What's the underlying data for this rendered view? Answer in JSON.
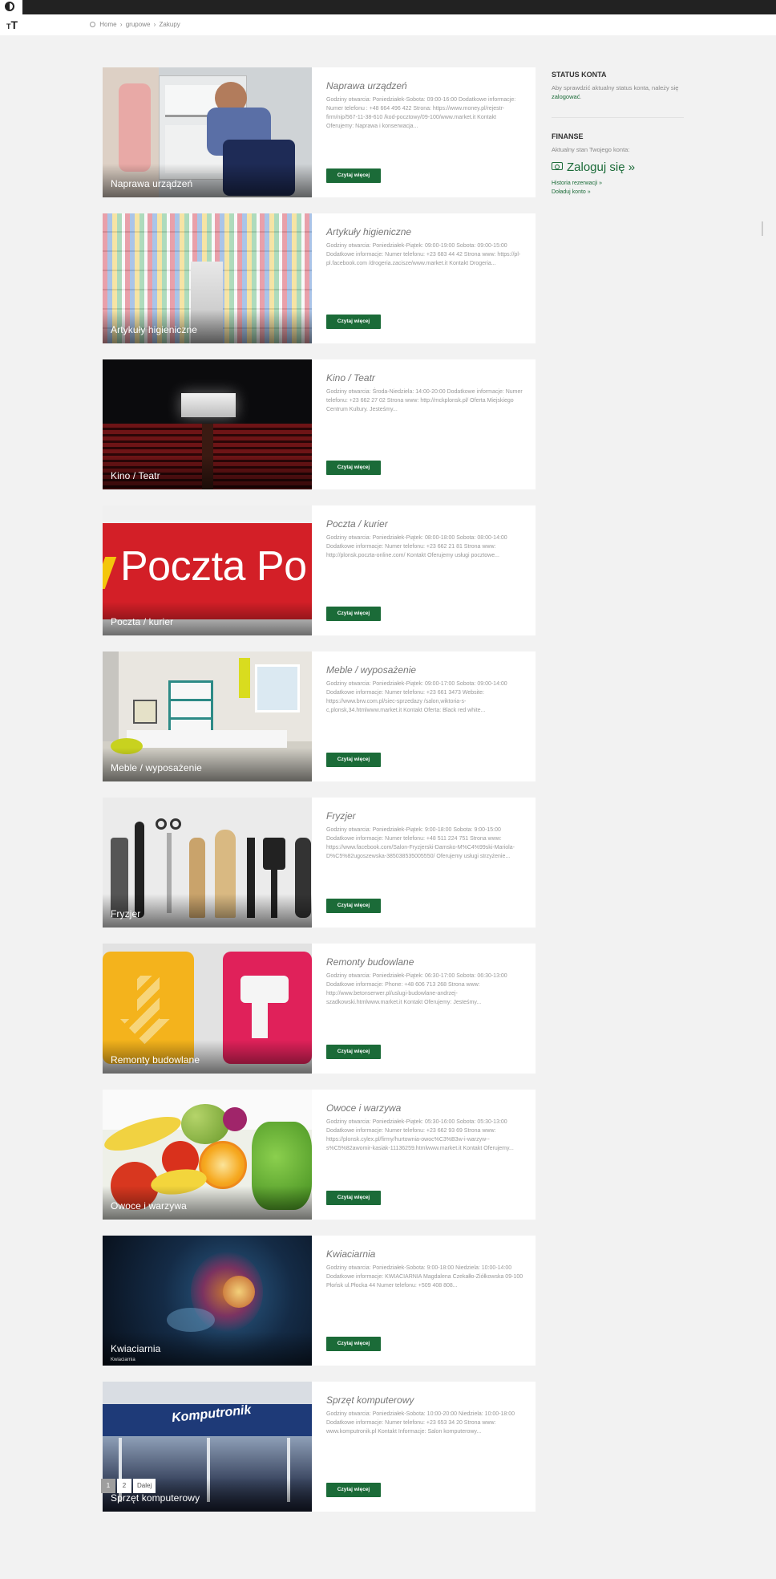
{
  "accessibility": {
    "contrast_icon": "contrast-icon",
    "text_size_label": "T"
  },
  "breadcrumb": {
    "items": [
      "Home",
      "grupowe",
      "Zakupy"
    ],
    "separator": "›"
  },
  "cards": [
    {
      "caption": "Naprawa urządzeń",
      "title": "Naprawa urządzeń",
      "desc": "Godziny otwarcia: Poniedziałek-Sobota: 09:00-16:00 Dodatkowe informacje: Numer telefonu : +48 664 496 422 Strona: https://www.money.pl/rejestr-firm/nip/567-11-38-610 /kod-pocztowy/09-100/www.market.it Kontakt Oferujemy: Naprawa i konserwacja...",
      "button": "Czytaj więcej"
    },
    {
      "caption": "Artykuły higieniczne",
      "title": "Artykuły higieniczne",
      "desc": "Godziny otwarcia: Poniedziałek-Piątek: 09:00-19:00 Sobota: 09:00-15:00 Dodatkowe informacje: Numer telefonu: +23 683 44 42 Strona www: https://pl-pl.facebook.com /drogeria.zacisze/www.market.it Kontakt Drogeria...",
      "button": "Czytaj więcej"
    },
    {
      "caption": "Kino / Teatr",
      "title": "Kino / Teatr",
      "desc": "Godziny otwarcia: Środa-Niedziela: 14:00-20:00 Dodatkowe informacje: Numer telefonu: +23 662 27 02 Strona www: http://mckplonsk.pl/ Oferta Miejskiego Centrum Kultury. Jesteśmy...",
      "button": "Czytaj więcej"
    },
    {
      "caption": "Poczta / kurier",
      "title": "Poczta / kurier",
      "desc": "Godziny otwarcia: Poniedziałek-Piątek: 08:00-18:00 Sobota: 08:00-14:00 Dodatkowe informacje: Numer telefonu: +23 662 21 81 Strona www: http://plonsk.poczta-online.com/ Kontakt Oferujemy usługi pocztowe...",
      "button": "Czytaj więcej"
    },
    {
      "caption": "Meble / wyposażenie",
      "title": "Meble / wyposażenie",
      "desc": "Godziny otwarcia: Poniedziałek-Piątek: 09:00-17:00 Sobota: 09:00-14:00 Dodatkowe informacje: Numer telefonu: +23 661 3473 Website: https://www.brw.com.pl/siec-sprzedazy /salon,wiktoria-s-c,plonsk,34.htmlwww.market.it Kontakt Oferta: Black red white...",
      "button": "Czytaj więcej"
    },
    {
      "caption": "Fryzjer",
      "title": "Fryzjer",
      "desc": "Godziny otwarcia: Poniedziałek-Piątek: 9:00-18:00 Sobota: 9:00-15:00 Dodatkowe informacje: Numer telefonu: +48 511 224 751 Strona www: https://www.facebook.com/Salon-Fryzjerski-Damsko-M%C4%99ski-Mariola-D%C5%82ugoszewska-385038535005550/ Oferujemy usługi strzyżenie...",
      "button": "Czytaj więcej"
    },
    {
      "caption": "Remonty budowlane",
      "title": "Remonty budowlane",
      "desc": "Godziny otwarcia: Poniedziałek-Piątek: 06:30-17:00 Sobota: 06:30-13:00 Dodatkowe informacje: Phone: +48 606 713 268 Strona www: http://www.betonserwer.pl/uslugi-budowlane-andrzej-szadkowski.htmlwww.market.it Kontakt Oferujemy: Jesteśmy...",
      "button": "Czytaj więcej"
    },
    {
      "caption": "Owoce i warzywa",
      "title": "Owoce i warzywa",
      "desc": "Godziny otwarcia: Poniedziałek-Piątek: 05:30-16:00 Sobota: 05:30-13:00 Dodatkowe informacje: Numer telefonu: +23 662 93 69 Strona www: https://plonsk.cylex.pl/firmy/hurtownia-owoc%C3%B3w-i-warzyw--s%C5%82awomir-kasiak-11136259.htmlwww.market.it Kontakt Oferujemy...",
      "button": "Czytaj więcej"
    },
    {
      "caption": "Kwiaciarnia",
      "subcaption": "Kwiaciarnia",
      "title": "Kwiaciarnia",
      "desc": "Godziny otwarcia: Poniedziałek-Sobota: 9:00-18:00 Niedziela: 10:00-14:00 Dodatkowe informacje: KWIACIARNIA Magdalena Czekałło-Ziółkowska 09-100 Płońsk ul.Płocka 44 Numer telefonu: +509 408 808...",
      "button": "Czytaj więcej"
    },
    {
      "caption": "Sprzęt komputerowy",
      "title": "Sprzęt komputerowy",
      "desc": "Godziny otwarcia: Poniedziałek-Sobota: 10:00-20:00 Niedziela: 10:00-18:00 Dodatkowe informacje: Numer telefonu: +23 653 34 20 Strona www: www.komputronik.pl Kontakt Informacje: Salon komputerowy...",
      "button": "Czytaj więcej"
    }
  ],
  "sidebar": {
    "status": {
      "title": "STATUS KONTA",
      "text": "Aby sprawdzić aktualny status konta, należy się",
      "link": "zalogować",
      "suffix": "."
    },
    "finance": {
      "title": "FINANSE",
      "text": "Aktualny stan Twojego konta:",
      "login": "Zaloguj się »",
      "history": "Historia rezerwacji »",
      "topup": "Doładuj konto »"
    }
  },
  "thumb_texts": {
    "poczta": "Poczta Po",
    "komputronik": "Komputronik"
  },
  "pagination": {
    "pages": [
      "1",
      "2"
    ],
    "next": "Dalej",
    "active": "1"
  },
  "colors": {
    "accent": "#1b6b38",
    "topbar": "#222222",
    "poczta_red": "#d31f27",
    "poczta_yellow": "#f4c60c"
  }
}
